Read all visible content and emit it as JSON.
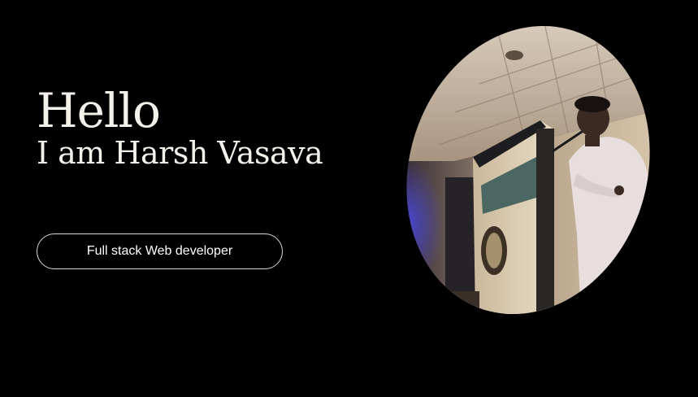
{
  "hero": {
    "greeting": "Hello",
    "intro": "I am Harsh Vasava",
    "role_label": "Full stack Web developer"
  },
  "portrait": {
    "icon": "portrait-photo-icon",
    "subject": "speaker-at-podium"
  },
  "colors": {
    "background": "#000000",
    "text": "#f4f1ea",
    "pill_border": "#d9d9d9"
  }
}
